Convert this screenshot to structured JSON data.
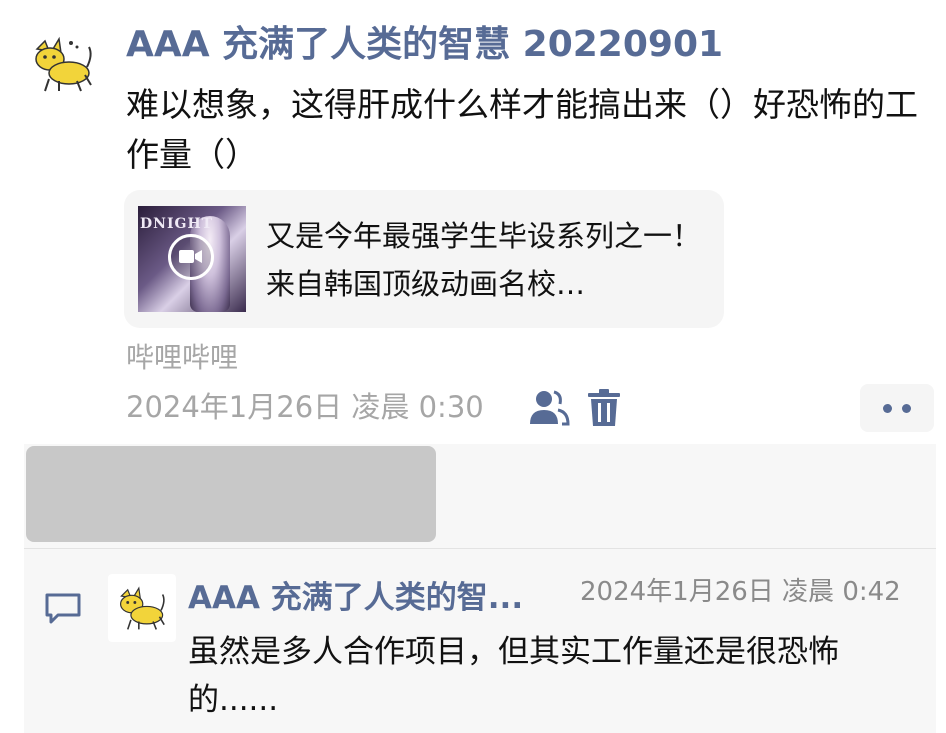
{
  "post": {
    "author": "AAA 充满了人类的智慧 20220901",
    "text": "难以想象，这得肝成什么样才能搞出来（）好恐怖的工作量（）",
    "link_card": {
      "title": "又是今年最强学生毕设系列之一！来自韩国顶级动画名校…",
      "thumbnail_text": "DNIGHT"
    },
    "source": "哔哩哔哩",
    "timestamp": "2024年1月26日 凌晨 0:30"
  },
  "icons": {
    "avatar": "yellow-cat-avatar",
    "visibility": "people-icon",
    "delete": "trash-icon",
    "more": "more-dots-icon",
    "comment": "comment-bubble-icon",
    "play": "video-camera-icon"
  },
  "comment": {
    "author": "AAA 充满了人类的智...",
    "time": "2024年1月26日 凌晨 0:42",
    "text": "虽然是多人合作项目，但其实工作量还是很恐怖的......"
  },
  "colors": {
    "link_blue": "#576b95",
    "meta_gray": "#a6a6a6",
    "panel_bg": "#f7f7f7"
  }
}
